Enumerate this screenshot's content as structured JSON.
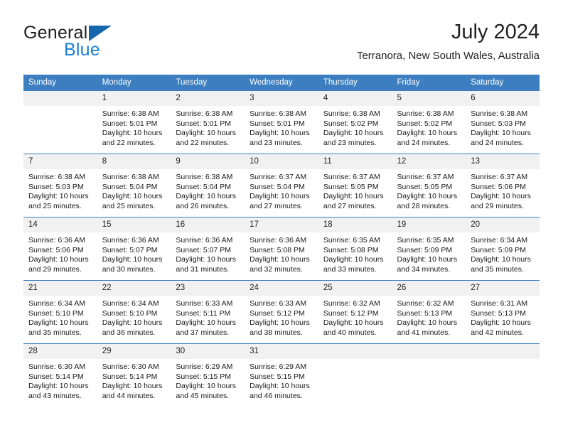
{
  "logo": {
    "word1": "General",
    "word2": "Blue",
    "triangle_color": "#1566ad",
    "blue_color": "#1b7fd4"
  },
  "header": {
    "title": "July 2024",
    "subtitle": "Terranora, New South Wales, Australia",
    "header_bg": "#3c7ebf"
  },
  "weekdays": [
    "Sunday",
    "Monday",
    "Tuesday",
    "Wednesday",
    "Thursday",
    "Friday",
    "Saturday"
  ],
  "labels": {
    "sunrise": "Sunrise:",
    "sunset": "Sunset:",
    "daylight": "Daylight:"
  },
  "weeks": [
    [
      {
        "day": "",
        "empty": true
      },
      {
        "day": "1",
        "sunrise": "Sunrise: 6:38 AM",
        "sunset": "Sunset: 5:01 PM",
        "daylight1": "Daylight: 10 hours",
        "daylight2": "and 22 minutes."
      },
      {
        "day": "2",
        "sunrise": "Sunrise: 6:38 AM",
        "sunset": "Sunset: 5:01 PM",
        "daylight1": "Daylight: 10 hours",
        "daylight2": "and 22 minutes."
      },
      {
        "day": "3",
        "sunrise": "Sunrise: 6:38 AM",
        "sunset": "Sunset: 5:01 PM",
        "daylight1": "Daylight: 10 hours",
        "daylight2": "and 23 minutes."
      },
      {
        "day": "4",
        "sunrise": "Sunrise: 6:38 AM",
        "sunset": "Sunset: 5:02 PM",
        "daylight1": "Daylight: 10 hours",
        "daylight2": "and 23 minutes."
      },
      {
        "day": "5",
        "sunrise": "Sunrise: 6:38 AM",
        "sunset": "Sunset: 5:02 PM",
        "daylight1": "Daylight: 10 hours",
        "daylight2": "and 24 minutes."
      },
      {
        "day": "6",
        "sunrise": "Sunrise: 6:38 AM",
        "sunset": "Sunset: 5:03 PM",
        "daylight1": "Daylight: 10 hours",
        "daylight2": "and 24 minutes."
      }
    ],
    [
      {
        "day": "7",
        "sunrise": "Sunrise: 6:38 AM",
        "sunset": "Sunset: 5:03 PM",
        "daylight1": "Daylight: 10 hours",
        "daylight2": "and 25 minutes."
      },
      {
        "day": "8",
        "sunrise": "Sunrise: 6:38 AM",
        "sunset": "Sunset: 5:04 PM",
        "daylight1": "Daylight: 10 hours",
        "daylight2": "and 25 minutes."
      },
      {
        "day": "9",
        "sunrise": "Sunrise: 6:38 AM",
        "sunset": "Sunset: 5:04 PM",
        "daylight1": "Daylight: 10 hours",
        "daylight2": "and 26 minutes."
      },
      {
        "day": "10",
        "sunrise": "Sunrise: 6:37 AM",
        "sunset": "Sunset: 5:04 PM",
        "daylight1": "Daylight: 10 hours",
        "daylight2": "and 27 minutes."
      },
      {
        "day": "11",
        "sunrise": "Sunrise: 6:37 AM",
        "sunset": "Sunset: 5:05 PM",
        "daylight1": "Daylight: 10 hours",
        "daylight2": "and 27 minutes."
      },
      {
        "day": "12",
        "sunrise": "Sunrise: 6:37 AM",
        "sunset": "Sunset: 5:05 PM",
        "daylight1": "Daylight: 10 hours",
        "daylight2": "and 28 minutes."
      },
      {
        "day": "13",
        "sunrise": "Sunrise: 6:37 AM",
        "sunset": "Sunset: 5:06 PM",
        "daylight1": "Daylight: 10 hours",
        "daylight2": "and 29 minutes."
      }
    ],
    [
      {
        "day": "14",
        "sunrise": "Sunrise: 6:36 AM",
        "sunset": "Sunset: 5:06 PM",
        "daylight1": "Daylight: 10 hours",
        "daylight2": "and 29 minutes."
      },
      {
        "day": "15",
        "sunrise": "Sunrise: 6:36 AM",
        "sunset": "Sunset: 5:07 PM",
        "daylight1": "Daylight: 10 hours",
        "daylight2": "and 30 minutes."
      },
      {
        "day": "16",
        "sunrise": "Sunrise: 6:36 AM",
        "sunset": "Sunset: 5:07 PM",
        "daylight1": "Daylight: 10 hours",
        "daylight2": "and 31 minutes."
      },
      {
        "day": "17",
        "sunrise": "Sunrise: 6:36 AM",
        "sunset": "Sunset: 5:08 PM",
        "daylight1": "Daylight: 10 hours",
        "daylight2": "and 32 minutes."
      },
      {
        "day": "18",
        "sunrise": "Sunrise: 6:35 AM",
        "sunset": "Sunset: 5:08 PM",
        "daylight1": "Daylight: 10 hours",
        "daylight2": "and 33 minutes."
      },
      {
        "day": "19",
        "sunrise": "Sunrise: 6:35 AM",
        "sunset": "Sunset: 5:09 PM",
        "daylight1": "Daylight: 10 hours",
        "daylight2": "and 34 minutes."
      },
      {
        "day": "20",
        "sunrise": "Sunrise: 6:34 AM",
        "sunset": "Sunset: 5:09 PM",
        "daylight1": "Daylight: 10 hours",
        "daylight2": "and 35 minutes."
      }
    ],
    [
      {
        "day": "21",
        "sunrise": "Sunrise: 6:34 AM",
        "sunset": "Sunset: 5:10 PM",
        "daylight1": "Daylight: 10 hours",
        "daylight2": "and 35 minutes."
      },
      {
        "day": "22",
        "sunrise": "Sunrise: 6:34 AM",
        "sunset": "Sunset: 5:10 PM",
        "daylight1": "Daylight: 10 hours",
        "daylight2": "and 36 minutes."
      },
      {
        "day": "23",
        "sunrise": "Sunrise: 6:33 AM",
        "sunset": "Sunset: 5:11 PM",
        "daylight1": "Daylight: 10 hours",
        "daylight2": "and 37 minutes."
      },
      {
        "day": "24",
        "sunrise": "Sunrise: 6:33 AM",
        "sunset": "Sunset: 5:12 PM",
        "daylight1": "Daylight: 10 hours",
        "daylight2": "and 38 minutes."
      },
      {
        "day": "25",
        "sunrise": "Sunrise: 6:32 AM",
        "sunset": "Sunset: 5:12 PM",
        "daylight1": "Daylight: 10 hours",
        "daylight2": "and 40 minutes."
      },
      {
        "day": "26",
        "sunrise": "Sunrise: 6:32 AM",
        "sunset": "Sunset: 5:13 PM",
        "daylight1": "Daylight: 10 hours",
        "daylight2": "and 41 minutes."
      },
      {
        "day": "27",
        "sunrise": "Sunrise: 6:31 AM",
        "sunset": "Sunset: 5:13 PM",
        "daylight1": "Daylight: 10 hours",
        "daylight2": "and 42 minutes."
      }
    ],
    [
      {
        "day": "28",
        "sunrise": "Sunrise: 6:30 AM",
        "sunset": "Sunset: 5:14 PM",
        "daylight1": "Daylight: 10 hours",
        "daylight2": "and 43 minutes."
      },
      {
        "day": "29",
        "sunrise": "Sunrise: 6:30 AM",
        "sunset": "Sunset: 5:14 PM",
        "daylight1": "Daylight: 10 hours",
        "daylight2": "and 44 minutes."
      },
      {
        "day": "30",
        "sunrise": "Sunrise: 6:29 AM",
        "sunset": "Sunset: 5:15 PM",
        "daylight1": "Daylight: 10 hours",
        "daylight2": "and 45 minutes."
      },
      {
        "day": "31",
        "sunrise": "Sunrise: 6:29 AM",
        "sunset": "Sunset: 5:15 PM",
        "daylight1": "Daylight: 10 hours",
        "daylight2": "and 46 minutes."
      },
      {
        "day": "",
        "empty": true
      },
      {
        "day": "",
        "empty": true
      },
      {
        "day": "",
        "empty": true
      }
    ]
  ]
}
